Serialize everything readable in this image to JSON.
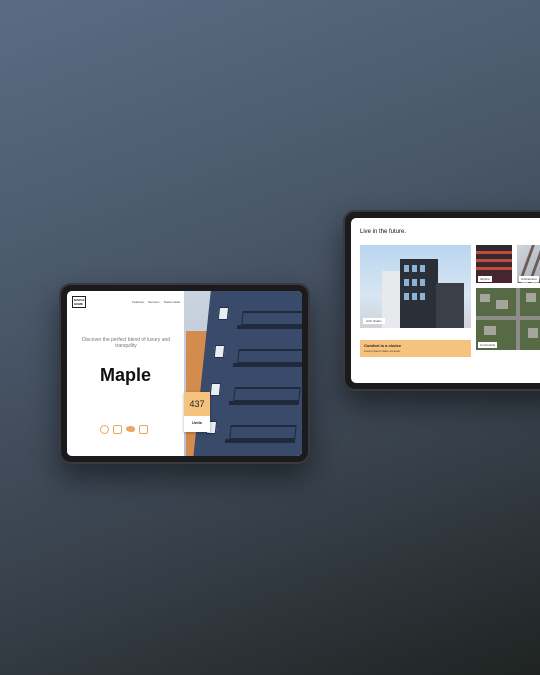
{
  "tablet_left": {
    "nav_items": [
      "Features",
      "Services",
      "Testimonials"
    ],
    "tagline": "Discover the perfect blend of luxury and tranquility",
    "brand": "Maple",
    "units_count": "437",
    "units_label": "Units",
    "social_icons": [
      "facebook-icon",
      "instagram-icon",
      "twitter-icon",
      "linkedin-icon"
    ],
    "accent_color": "#f5c37d"
  },
  "tablet_right": {
    "section_title": "Live in the future.",
    "hero_tag": "Arch Studio",
    "promo_title": "Comfort is a choice",
    "promo_subtitle": "Lorem ipsum dolor sit amet",
    "thumb_tags": [
      "Skyline",
      "Architecture",
      "Community"
    ]
  }
}
